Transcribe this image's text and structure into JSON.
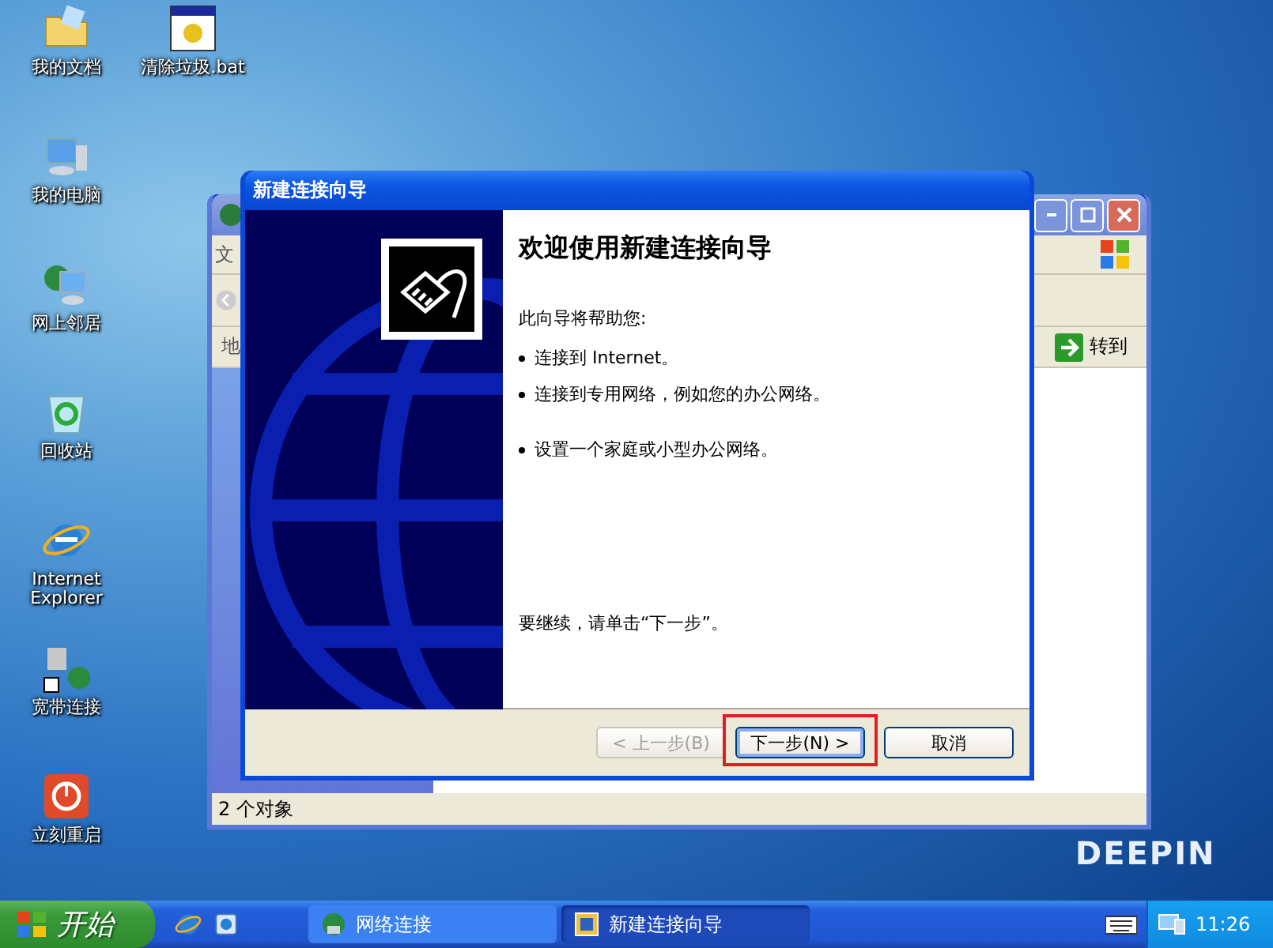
{
  "desktop": {
    "icon_columns": [
      [
        {
          "label": "我的文档",
          "kind": "folder"
        },
        {
          "label": "我的电脑",
          "kind": "computer"
        },
        {
          "label": "网上邻居",
          "kind": "network"
        },
        {
          "label": "回收站",
          "kind": "recycle"
        },
        {
          "label": "Internet Explorer",
          "kind": "browser"
        },
        {
          "label": "宽带连接",
          "kind": "broadband"
        },
        {
          "label": "立刻重启",
          "kind": "restart"
        }
      ],
      [
        {
          "label": "清除垃圾.bat",
          "kind": "batch"
        }
      ]
    ],
    "wallpaper_logo": "DEEPIN"
  },
  "back_window": {
    "menu_text": "文",
    "address_label": "地",
    "go_button": "转到",
    "status": "2 个对象"
  },
  "wizard": {
    "title": "新建连接向导",
    "heading": "欢迎使用新建连接向导",
    "intro": "此向导将帮助您:",
    "bullet_groups": [
      [
        "连接到 Internet。",
        "连接到专用网络，例如您的办公网络。"
      ],
      [
        "设置一个家庭或小型办公网络。"
      ]
    ],
    "footer_text": "要继续，请单击“下一步”。",
    "buttons": [
      {
        "label": "< 上一步(B)",
        "disabled": true,
        "highlighted": false,
        "default": false
      },
      {
        "label": "下一步(N) >",
        "disabled": false,
        "highlighted": true,
        "default": true
      },
      {
        "label": "取消",
        "disabled": false,
        "highlighted": false,
        "default": false
      }
    ]
  },
  "taskbar": {
    "start": "开始",
    "tasks": [
      {
        "label": "网络连接",
        "selected": false,
        "kind": "network"
      },
      {
        "label": "新建连接向导",
        "selected": true,
        "kind": "wizard"
      }
    ],
    "clock": "11:26"
  }
}
